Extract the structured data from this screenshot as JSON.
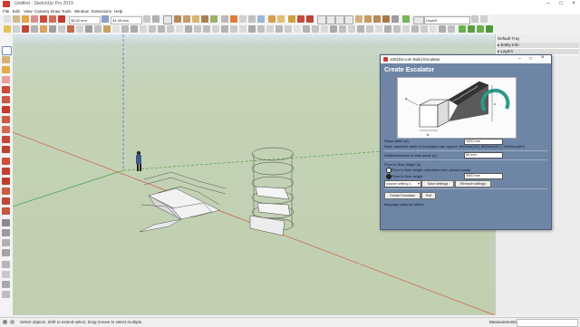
{
  "window": {
    "title": "Untitled - SketchUp Pro 2019"
  },
  "menu": [
    "File",
    "Edit",
    "View",
    "Camera",
    "Draw",
    "Tools",
    "Window",
    "Extensions",
    "Help"
  ],
  "toolbar": {
    "left_field": "38.42 mm",
    "right_field": "34.45 mm",
    "layer_select": "Layer0"
  },
  "tray": {
    "title": "Default Tray",
    "panels": [
      "Entity Info",
      "Layers"
    ]
  },
  "dialog": {
    "title": "1001bit.com Build Escalator",
    "heading": "Create Escalator",
    "step_width_label": "Steps width (a)",
    "step_width_value": "1000 mm",
    "note": "Note: standard width of escalators are approx. 600mm(24\"), 800mm(32\"), 1000mm(40\")",
    "side_panel_label": "Width/thickness of side panel (b)",
    "side_panel_value": "50 mm",
    "floor_height_label": "Floor to floor height (c)",
    "radio_picked": "Floor to floor height calculated from picked points",
    "radio_fixed": "Floor to floor height",
    "fixed_height_value": "3000 mm",
    "settings_select": "custom setting 1",
    "save_button": "Save settings",
    "remove_button": "Remove settings",
    "create_button": "Create Escalator",
    "exit_button": "Exit",
    "language_note": "language pack by author"
  },
  "status": {
    "hint": "Select objects. Shift to extend select. Drag mouse to select multiple.",
    "measurements_label": "Measurements"
  },
  "colors": {
    "dialog_bg": "#6e85a5",
    "viewport_ground": "#c4d3b6",
    "sky": "#d9e6ee"
  }
}
